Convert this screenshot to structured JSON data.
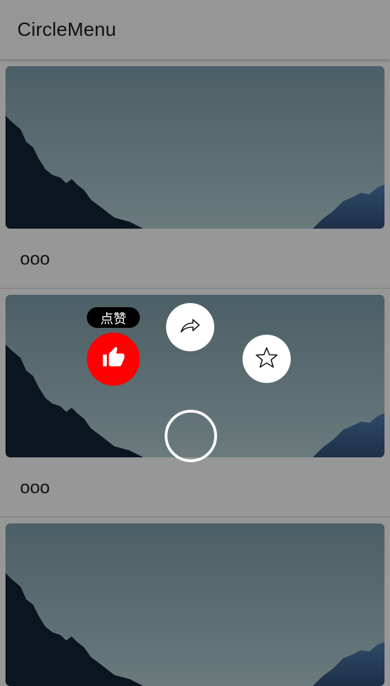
{
  "app": {
    "title": "CircleMenu"
  },
  "cards": [
    {
      "more_label": "ooo"
    },
    {
      "more_label": "ooo"
    },
    {
      "more_label": ""
    }
  ],
  "circle_menu": {
    "tooltip": "点赞",
    "active_color": "#ff0000",
    "items": [
      {
        "icon": "thumbs-up-icon",
        "active": true
      },
      {
        "icon": "share-arrow-icon",
        "active": false
      },
      {
        "icon": "star-icon",
        "active": false
      }
    ],
    "center_icon": "circle-outline"
  }
}
